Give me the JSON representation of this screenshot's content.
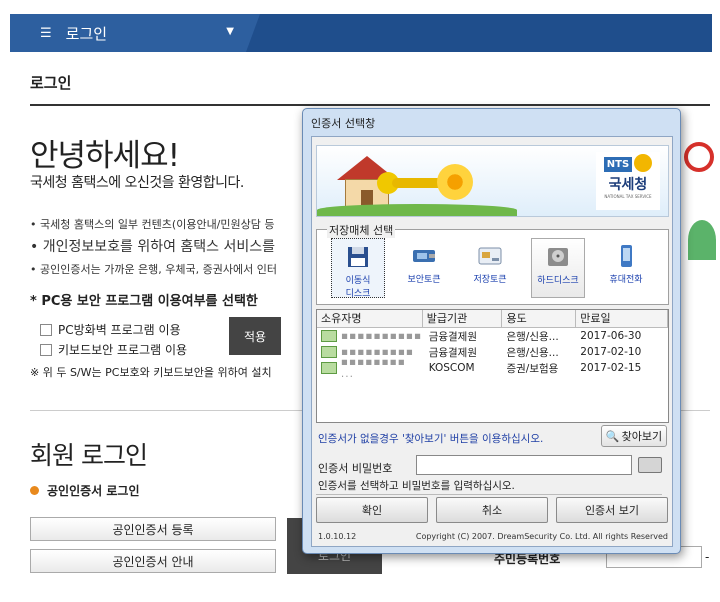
{
  "topbar": {
    "menu_label": "로그인"
  },
  "page": {
    "heading": "로그인",
    "hello": "안녕하세요!",
    "welcome": "국세청 홈택스에 오신것을 환영합니다.",
    "notices": [
      "• 국세청 홈택스의 일부 컨텐츠(이용안내/민원상담 등",
      "• 개인정보보호를 위하여 홈택스 서비스를",
      "• 공인인증서는 가까운 은행, 우체국, 증권사에서 인터"
    ],
    "pc_question": "* PC용 보안 프로그램 이용여부를 선택한",
    "options": [
      "PC방화벽 프로그램 이용",
      "키보드보안 프로그램 이용"
    ],
    "apply_label": "적용",
    "sw_note": "※ 위 두 S/W는 PC보호와 키보드보안을 위하여 설치",
    "member_login": "회원 로그인",
    "cert_login": "공인인증서 로그인",
    "cert_register": "공인인증서 등록",
    "cert_guide": "공인인증서 안내",
    "login_button": "로그인",
    "resident_label": "주민등록번호"
  },
  "dialog": {
    "title": "인증서 선택창",
    "banner": {
      "nts_mark": "NTS",
      "nts_name": "국세청",
      "nts_sub": "NATIONAL TAX SERVICE"
    },
    "media_legend": "저장매체 선택",
    "media": [
      {
        "label": "이동식\n디스크",
        "icon": "removable-disk-icon"
      },
      {
        "label": "보안토큰",
        "icon": "security-token-icon"
      },
      {
        "label": "저장토큰",
        "icon": "storage-token-icon"
      },
      {
        "label": "하드디스크",
        "icon": "hard-disk-icon"
      },
      {
        "label": "휴대전화",
        "icon": "mobile-phone-icon"
      }
    ],
    "columns": [
      "소유자명",
      "발급기관",
      "용도",
      "만료일"
    ],
    "rows": [
      {
        "owner": "▪▪▪▪▪▪▪▪▪▪",
        "issuer": "금융결제원",
        "usage": "은행/신용...",
        "expiry": "2017-06-30"
      },
      {
        "owner": "▪▪▪▪▪▪▪▪▪",
        "issuer": "금융결제원",
        "usage": "은행/신용...",
        "expiry": "2017-02-10"
      },
      {
        "owner": "▪▪▪▪▪▪▪▪ ...",
        "issuer": "KOSCOM",
        "usage": "증권/보험용",
        "expiry": "2017-02-15"
      }
    ],
    "hint": "인증서가 없을경우 '찾아보기' 버튼을 이용하십시오.",
    "find_label": "찾아보기",
    "password_label": "인증서 비밀번호",
    "status": "인증서를 선택하고 비밀번호를 입력하십시오.",
    "ok_label": "확인",
    "cancel_label": "취소",
    "view_label": "인증서 보기",
    "version": "1.0.10.12",
    "copyright": "Copyright (C) 2007. DreamSecurity Co. Ltd. All rights Reserved"
  },
  "colors": {
    "topbar": "#1f4e8c",
    "hint_text": "#1f3fa5",
    "accent_orange": "#e8891d"
  }
}
